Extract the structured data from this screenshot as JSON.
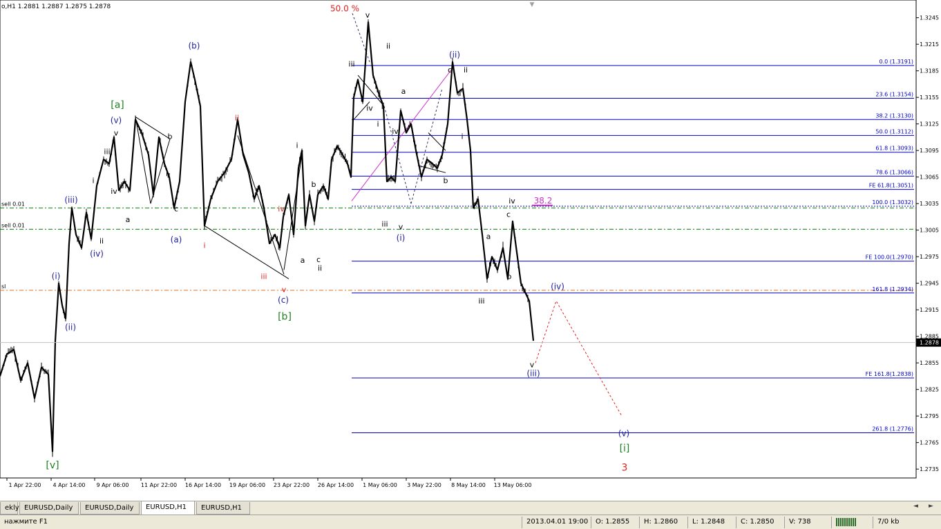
{
  "window": {
    "header_text": "o,H1  1.2881 1.2887 1.2875 1.2878",
    "top_marker": "▼"
  },
  "chart_data": {
    "type": "candlestick",
    "symbol": "EURUSD",
    "timeframe": "H1",
    "ohlc_header": {
      "open": 1.2881,
      "high": 1.2887,
      "low": 1.2875,
      "close": 1.2878
    },
    "current_price": "1.2878",
    "ylim": [
      1.2725,
      1.3265
    ],
    "y_ticks": [
      "1.3245",
      "1.3215",
      "1.3185",
      "1.3155",
      "1.3125",
      "1.3095",
      "1.3065",
      "1.3035",
      "1.3005",
      "1.2975",
      "1.2945",
      "1.2915",
      "1.2885",
      "1.2855",
      "1.2825",
      "1.2795",
      "1.2765",
      "1.2735"
    ],
    "x_tick_labels": [
      "1 Apr 22:00",
      "4 Apr 14:00",
      "9 Apr 06:00",
      "11 Apr 22:00",
      "16 Apr 14:00",
      "19 Apr 06:00",
      "23 Apr 22:00",
      "26 Apr 14:00",
      "1 May 06:00",
      "3 May 22:00",
      "8 May 14:00",
      "13 May 06:00"
    ],
    "price_path": [
      [
        0,
        1.284
      ],
      [
        10,
        1.2865
      ],
      [
        20,
        1.287
      ],
      [
        30,
        1.2835
      ],
      [
        40,
        1.2855
      ],
      [
        50,
        1.2815
      ],
      [
        60,
        1.285
      ],
      [
        70,
        1.2842
      ],
      [
        76,
        1.2755
      ],
      [
        80,
        1.288
      ],
      [
        85,
        1.2945
      ],
      [
        90,
        1.292
      ],
      [
        95,
        1.2905
      ],
      [
        100,
        1.299
      ],
      [
        104,
        1.303
      ],
      [
        110,
        1.3
      ],
      [
        118,
        1.2985
      ],
      [
        125,
        1.3025
      ],
      [
        132,
        1.2995
      ],
      [
        140,
        1.3055
      ],
      [
        150,
        1.3085
      ],
      [
        158,
        1.308
      ],
      [
        165,
        1.311
      ],
      [
        172,
        1.305
      ],
      [
        180,
        1.306
      ],
      [
        188,
        1.305
      ],
      [
        196,
        1.313
      ],
      [
        205,
        1.3115
      ],
      [
        215,
        1.309
      ],
      [
        222,
        1.3045
      ],
      [
        230,
        1.311
      ],
      [
        238,
        1.308
      ],
      [
        245,
        1.3065
      ],
      [
        252,
        1.303
      ],
      [
        260,
        1.306
      ],
      [
        268,
        1.315
      ],
      [
        276,
        1.3195
      ],
      [
        282,
        1.3175
      ],
      [
        290,
        1.3145
      ],
      [
        296,
        1.301
      ],
      [
        305,
        1.304
      ],
      [
        315,
        1.306
      ],
      [
        325,
        1.307
      ],
      [
        335,
        1.3085
      ],
      [
        344,
        1.313
      ],
      [
        352,
        1.309
      ],
      [
        360,
        1.307
      ],
      [
        368,
        1.304
      ],
      [
        375,
        1.3055
      ],
      [
        382,
        1.303
      ],
      [
        390,
        1.299
      ],
      [
        398,
        1.3
      ],
      [
        405,
        1.2985
      ],
      [
        410,
        1.302
      ],
      [
        418,
        1.3045
      ],
      [
        425,
        1.3
      ],
      [
        432,
        1.3075
      ],
      [
        437,
        1.3095
      ],
      [
        442,
        1.301
      ],
      [
        448,
        1.3045
      ],
      [
        455,
        1.3015
      ],
      [
        460,
        1.3045
      ],
      [
        468,
        1.3055
      ],
      [
        475,
        1.304
      ],
      [
        480,
        1.3085
      ],
      [
        488,
        1.31
      ],
      [
        496,
        1.309
      ],
      [
        503,
        1.308
      ],
      [
        508,
        1.3065
      ],
      [
        512,
        1.3155
      ],
      [
        518,
        1.3175
      ],
      [
        525,
        1.315
      ],
      [
        533,
        1.324
      ],
      [
        540,
        1.318
      ],
      [
        548,
        1.316
      ],
      [
        555,
        1.3145
      ],
      [
        560,
        1.306
      ],
      [
        566,
        1.3065
      ],
      [
        572,
        1.306
      ],
      [
        580,
        1.314
      ],
      [
        588,
        1.3115
      ],
      [
        595,
        1.3125
      ],
      [
        602,
        1.3095
      ],
      [
        610,
        1.3065
      ],
      [
        618,
        1.3085
      ],
      [
        626,
        1.308
      ],
      [
        633,
        1.3075
      ],
      [
        640,
        1.309
      ],
      [
        648,
        1.3125
      ],
      [
        655,
        1.3195
      ],
      [
        662,
        1.316
      ],
      [
        670,
        1.3165
      ],
      [
        676,
        1.313
      ],
      [
        681,
        1.3095
      ],
      [
        685,
        1.303
      ],
      [
        692,
        1.304
      ],
      [
        698,
        1.3
      ],
      [
        705,
        1.295
      ],
      [
        712,
        1.2975
      ],
      [
        720,
        1.296
      ],
      [
        728,
        1.2985
      ],
      [
        735,
        1.295
      ],
      [
        742,
        1.3015
      ],
      [
        748,
        1.298
      ],
      [
        754,
        1.2945
      ],
      [
        760,
        1.2935
      ],
      [
        766,
        1.2925
      ],
      [
        772,
        1.288
      ]
    ],
    "fib_levels": [
      {
        "label": "0.0 (1.3191)",
        "price": 1.3191,
        "style": "solid",
        "color": "#0000c8"
      },
      {
        "label": "23.6 (1.3154)",
        "price": 1.3154,
        "style": "solid",
        "color": "#0000c8"
      },
      {
        "label": "38.2 (1.3130)",
        "price": 1.313,
        "style": "solid",
        "color": "#0000c8"
      },
      {
        "label": "50.0 (1.3112)",
        "price": 1.3112,
        "style": "solid",
        "color": "#0000c8"
      },
      {
        "label": "61.8 (1.3093)",
        "price": 1.3093,
        "style": "solid",
        "color": "#0000c8"
      },
      {
        "label": "78.6 (1.3066)",
        "price": 1.3066,
        "style": "solid",
        "color": "#0000c8"
      },
      {
        "label": "FE 61.8(1.3051)",
        "price": 1.3051,
        "style": "solid",
        "color": "#0000c8"
      },
      {
        "label": "100.0 (1.3032)",
        "price": 1.3032,
        "style": "dot",
        "color": "#0000c8"
      },
      {
        "label": "FE 100.0(1.2970)",
        "price": 1.297,
        "style": "solid",
        "color": "#0000c8"
      },
      {
        "label": "161.8 (1.2934)",
        "price": 1.2934,
        "style": "solid",
        "color": "#0000c8"
      },
      {
        "label": "FE 161.8(1.2838)",
        "price": 1.2838,
        "style": "solid",
        "color": "#0000c8"
      },
      {
        "label": "261.8 (1.2776)",
        "price": 1.2776,
        "style": "solid",
        "color": "#0000c8"
      }
    ],
    "order_lines": [
      {
        "label": "sell 0.01",
        "price": 1.303,
        "color": "#008000",
        "style": "dashdot"
      },
      {
        "label": "sell 0.01",
        "price": 1.3006,
        "color": "#008000",
        "style": "dashdot"
      },
      {
        "label": "sl",
        "price": 1.2937,
        "color": "#e07020",
        "style": "dashdot"
      }
    ],
    "annotations": [
      {
        "text": "50.0 %",
        "x": 499,
        "price": 1.3252,
        "color": "#e02020",
        "size": 12
      },
      {
        "text": "38.2",
        "x": 786,
        "price": 1.3035,
        "color": "#cc33cc",
        "size": 12
      },
      {
        "text": "v",
        "x": 532,
        "price": 1.3245,
        "color": "#000000",
        "size": 11
      },
      {
        "text": "ii",
        "x": 562,
        "price": 1.321,
        "color": "#000000",
        "size": 11
      },
      {
        "text": "iii",
        "x": 509,
        "price": 1.319,
        "color": "#000000",
        "size": 11
      },
      {
        "text": "(ii)",
        "x": 658,
        "price": 1.32,
        "color": "#2020a0",
        "size": 12
      },
      {
        "text": "c",
        "x": 651,
        "price": 1.3183,
        "color": "#000000",
        "size": 11
      },
      {
        "text": "ii",
        "x": 674,
        "price": 1.3183,
        "color": "#000000",
        "size": 11
      },
      {
        "text": "a",
        "x": 584,
        "price": 1.3159,
        "color": "#000000",
        "size": 11
      },
      {
        "text": "iv",
        "x": 535,
        "price": 1.314,
        "color": "#000000",
        "size": 11
      },
      {
        "text": "i",
        "x": 547,
        "price": 1.3122,
        "color": "#000000",
        "size": 11
      },
      {
        "text": "iv",
        "x": 572,
        "price": 1.3114,
        "color": "#000000",
        "size": 11
      },
      {
        "text": "i",
        "x": 669,
        "price": 1.3108,
        "color": "#000000",
        "size": 11
      },
      {
        "text": "b",
        "x": 645,
        "price": 1.3058,
        "color": "#000000",
        "size": 11
      },
      {
        "text": "iii",
        "x": 557,
        "price": 1.3009,
        "color": "#000000",
        "size": 11
      },
      {
        "text": "v",
        "x": 580,
        "price": 1.3006,
        "color": "#000000",
        "size": 11
      },
      {
        "text": "(i)",
        "x": 580,
        "price": 1.2993,
        "color": "#2020a0",
        "size": 12
      },
      {
        "text": "iv",
        "x": 741,
        "price": 1.3035,
        "color": "#000000",
        "size": 11
      },
      {
        "text": "c",
        "x": 736,
        "price": 1.302,
        "color": "#000000",
        "size": 11
      },
      {
        "text": "a",
        "x": 707,
        "price": 1.2995,
        "color": "#000000",
        "size": 11
      },
      {
        "text": "b",
        "x": 737,
        "price": 1.295,
        "color": "#000000",
        "size": 11
      },
      {
        "text": "iii",
        "x": 697,
        "price": 1.2922,
        "color": "#000000",
        "size": 11
      },
      {
        "text": "(iv)",
        "x": 807,
        "price": 1.2938,
        "color": "#2020a0",
        "size": 12
      },
      {
        "text": "v",
        "x": 770,
        "price": 1.285,
        "color": "#000000",
        "size": 11
      },
      {
        "text": "(iii)",
        "x": 772,
        "price": 1.284,
        "color": "#2020a0",
        "size": 12
      },
      {
        "text": "(v)",
        "x": 903,
        "price": 1.2772,
        "color": "#2020a0",
        "size": 12
      },
      {
        "text": "[i]",
        "x": 904,
        "price": 1.2755,
        "color": "#208020",
        "size": 14
      },
      {
        "text": "3",
        "x": 904,
        "price": 1.2733,
        "color": "#e02020",
        "size": 14
      },
      {
        "text": "[a]",
        "x": 170,
        "price": 1.3143,
        "color": "#208020",
        "size": 14
      },
      {
        "text": "(v)",
        "x": 168,
        "price": 1.3126,
        "color": "#2020a0",
        "size": 12
      },
      {
        "text": "v",
        "x": 168,
        "price": 1.3112,
        "color": "#000000",
        "size": 11
      },
      {
        "text": "iii",
        "x": 155,
        "price": 1.3091,
        "color": "#000000",
        "size": 11
      },
      {
        "text": "i",
        "x": 135,
        "price": 1.3058,
        "color": "#000000",
        "size": 11
      },
      {
        "text": "iv",
        "x": 165,
        "price": 1.3046,
        "color": "#000000",
        "size": 11
      },
      {
        "text": "b",
        "x": 246,
        "price": 1.3108,
        "color": "#000000",
        "size": 11
      },
      {
        "text": "(b)",
        "x": 281,
        "price": 1.321,
        "color": "#2020a0",
        "size": 12
      },
      {
        "text": "a",
        "x": 185,
        "price": 1.3014,
        "color": "#000000",
        "size": 11
      },
      {
        "text": "c",
        "x": 255,
        "price": 1.3026,
        "color": "#000000",
        "size": 11
      },
      {
        "text": "(a)",
        "x": 255,
        "price": 1.2991,
        "color": "#2020a0",
        "size": 12
      },
      {
        "text": "(iii)",
        "x": 103,
        "price": 1.3036,
        "color": "#2020a0",
        "size": 12
      },
      {
        "text": "ii",
        "x": 147,
        "price": 1.299,
        "color": "#000000",
        "size": 11
      },
      {
        "text": "(iv)",
        "x": 140,
        "price": 1.2975,
        "color": "#2020a0",
        "size": 12
      },
      {
        "text": "(i)",
        "x": 81,
        "price": 1.295,
        "color": "#2020a0",
        "size": 12
      },
      {
        "text": "(ii)",
        "x": 102,
        "price": 1.2892,
        "color": "#2020a0",
        "size": 12
      },
      {
        "text": "[v]",
        "x": 76,
        "price": 1.2736,
        "color": "#208020",
        "size": 14
      },
      {
        "text": "ii",
        "x": 343,
        "price": 1.3129,
        "color": "#e02020",
        "size": 11
      },
      {
        "text": "i",
        "x": 296,
        "price": 1.2985,
        "color": "#e02020",
        "size": 11
      },
      {
        "text": "iii",
        "x": 382,
        "price": 1.295,
        "color": "#e02020",
        "size": 11
      },
      {
        "text": "iv",
        "x": 407,
        "price": 1.3026,
        "color": "#e02020",
        "size": 11
      },
      {
        "text": "v",
        "x": 411,
        "price": 1.2935,
        "color": "#e02020",
        "size": 11
      },
      {
        "text": "i",
        "x": 430,
        "price": 1.3098,
        "color": "#000000",
        "size": 11
      },
      {
        "text": "b",
        "x": 454,
        "price": 1.3054,
        "color": "#000000",
        "size": 11
      },
      {
        "text": "a",
        "x": 438,
        "price": 1.2968,
        "color": "#000000",
        "size": 11
      },
      {
        "text": "c",
        "x": 461,
        "price": 1.2969,
        "color": "#000000",
        "size": 11
      },
      {
        "text": "ii",
        "x": 463,
        "price": 1.2959,
        "color": "#000000",
        "size": 11
      },
      {
        "text": "(c)",
        "x": 410,
        "price": 1.2923,
        "color": "#2020a0",
        "size": 12
      },
      {
        "text": "[b]",
        "x": 412,
        "price": 1.2904,
        "color": "#208020",
        "size": 14
      }
    ]
  },
  "tabs": [
    {
      "label": "ekly"
    },
    {
      "label": "EURUSD,Daily"
    },
    {
      "label": "EURUSD,Daily"
    },
    {
      "label": "EURUSD,H1",
      "active": true
    },
    {
      "label": "EURUSD,H1"
    }
  ],
  "tab_scroll": {
    "left": "◄",
    "right": "►"
  },
  "status": {
    "help": "нажмите F1",
    "datetime": "2013.04.01 19:00",
    "open": "O: 1.2855",
    "high": "H: 1.2860",
    "low": "L: 1.2848",
    "close": "C: 1.2850",
    "volume": "V: 738",
    "traffic": "7/0 kb"
  }
}
